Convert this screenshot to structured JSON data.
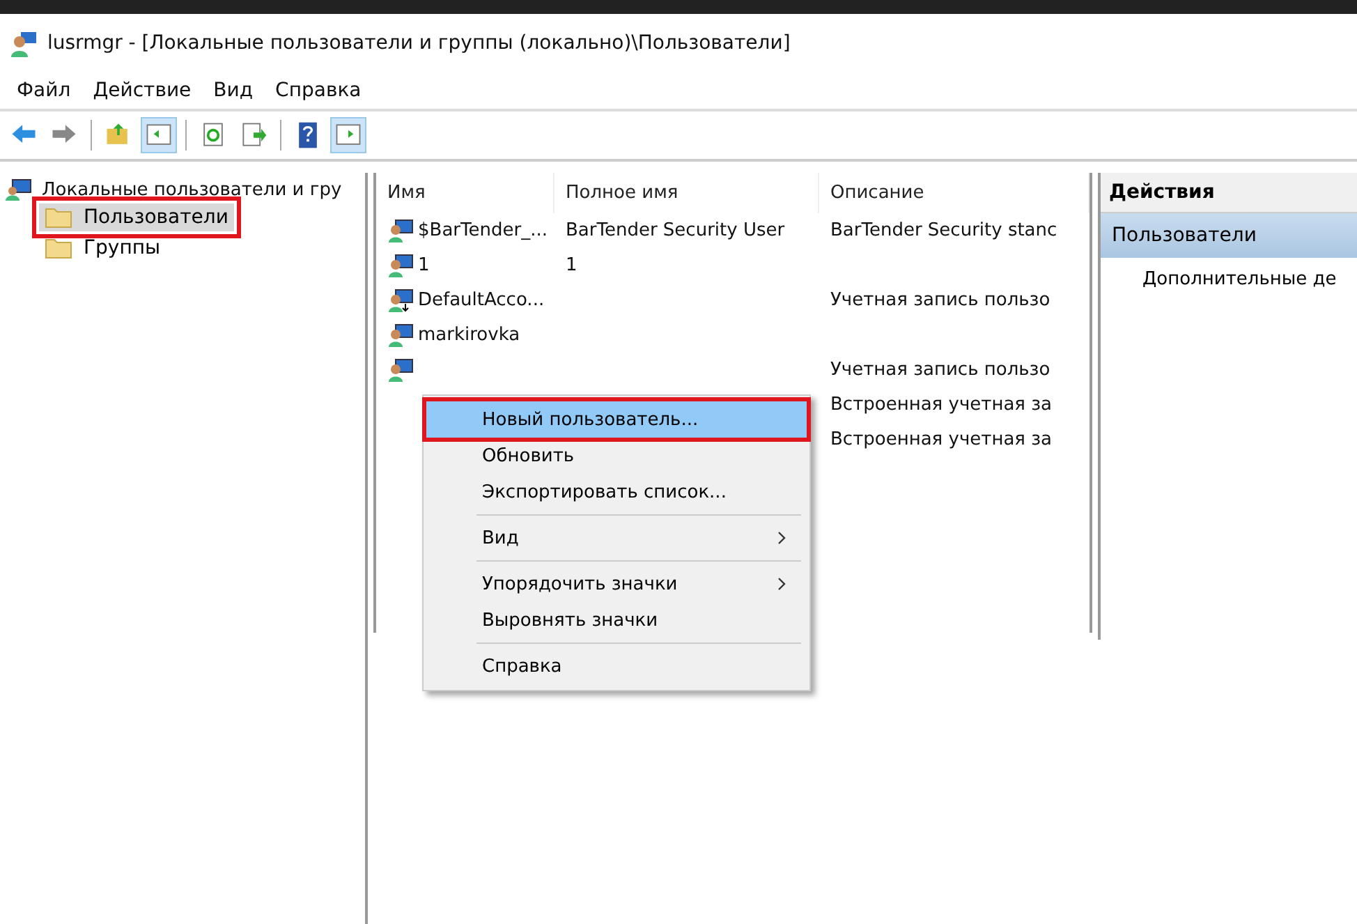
{
  "window": {
    "title": "lusrmgr - [Локальные пользователи и группы (локально)\\Пользователи]"
  },
  "menu": [
    "Файл",
    "Действие",
    "Вид",
    "Справка"
  ],
  "toolbar": [
    {
      "kind": "back",
      "selected": false
    },
    {
      "kind": "forward",
      "selected": false
    },
    {
      "kind": "sep"
    },
    {
      "kind": "up",
      "selected": false
    },
    {
      "kind": "tree",
      "selected": true
    },
    {
      "kind": "sep"
    },
    {
      "kind": "refresh",
      "selected": false
    },
    {
      "kind": "export",
      "selected": false
    },
    {
      "kind": "sep"
    },
    {
      "kind": "help",
      "selected": false
    },
    {
      "kind": "actions",
      "selected": true
    }
  ],
  "tree": {
    "label": "Локальные пользователи и гру",
    "children": [
      {
        "label": "Пользователи",
        "selected": true,
        "highlighted": true
      },
      {
        "label": "Группы",
        "selected": false,
        "highlighted": false
      }
    ]
  },
  "list": {
    "columns": [
      "Имя",
      "Полное имя",
      "Описание"
    ],
    "rows": [
      {
        "name": "$BarTender_...",
        "full_name": "BarTender Security User",
        "description": "BarTender Security stanc",
        "kind": "user"
      },
      {
        "name": "1",
        "full_name": "1",
        "description": "",
        "kind": "user"
      },
      {
        "name": "DefaultAcco...",
        "full_name": "",
        "description": "Учетная запись пользо",
        "kind": "managed"
      },
      {
        "name": "markirovka",
        "full_name": "",
        "description": "",
        "kind": "user"
      },
      {
        "name": "",
        "full_name": "",
        "description": "Учетная запись пользо",
        "kind": "user"
      },
      {
        "name": "",
        "full_name": "",
        "description": "Встроенная учетная за",
        "kind": "hidden"
      },
      {
        "name": "",
        "full_name": "",
        "description": "Встроенная учетная за",
        "kind": "hidden"
      }
    ]
  },
  "context_menu": [
    {
      "kind": "item",
      "label": "Новый пользователь...",
      "selected": true,
      "highlighted": true,
      "submenu": false
    },
    {
      "kind": "item",
      "label": "Обновить",
      "selected": false,
      "highlighted": false,
      "submenu": false
    },
    {
      "kind": "item",
      "label": "Экспортировать список...",
      "selected": false,
      "highlighted": false,
      "submenu": false
    },
    {
      "kind": "separator"
    },
    {
      "kind": "item",
      "label": "Вид",
      "selected": false,
      "highlighted": false,
      "submenu": true
    },
    {
      "kind": "separator"
    },
    {
      "kind": "item",
      "label": "Упорядочить значки",
      "selected": false,
      "highlighted": false,
      "submenu": true
    },
    {
      "kind": "item",
      "label": "Выровнять значки",
      "selected": false,
      "highlighted": false,
      "submenu": false
    },
    {
      "kind": "separator"
    },
    {
      "kind": "item",
      "label": "Справка",
      "selected": false,
      "highlighted": false,
      "submenu": false
    }
  ],
  "actions": {
    "title": "Действия",
    "section": "Пользователи",
    "items": [
      "Дополнительные де"
    ]
  }
}
